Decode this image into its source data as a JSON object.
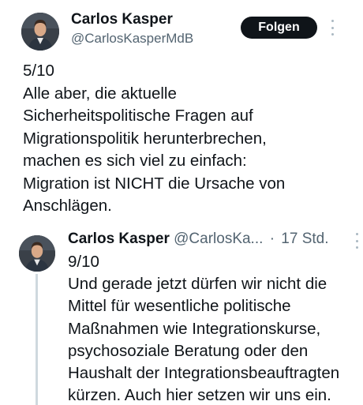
{
  "main_post": {
    "author_name": "Carlos Kasper",
    "author_handle": "@CarlosKasperMdB",
    "follow_label": "Folgen",
    "text": "5/10\nAlle aber, die aktuelle\nSicherheitspolitische Fragen auf\nMigrationspolitik herunterbrechen,\nmachen es sich viel zu einfach:\nMigration ist NICHT die Ursache von\nAnschlägen."
  },
  "reply_post": {
    "author_name": "Carlos Kasper",
    "author_handle": "@CarlosKa...",
    "separator": "·",
    "time": "17 Std.",
    "text": "9/10\nUnd gerade jetzt dürfen wir nicht die\nMittel für wesentliche politische\nMaßnahmen wie Integrationskurse,\npsychosoziale Beratung oder den\nHaushalt der Integrationsbeauftragten\nkürzen. Auch hier setzen wir uns ein."
  },
  "icons": {
    "more": "more-vertical-icon",
    "avatar": "profile-photo"
  },
  "colors": {
    "text": "#0f1419",
    "secondary_text": "#536471",
    "follow_button_bg": "#0f1419",
    "thread_line": "#cfd9de"
  }
}
